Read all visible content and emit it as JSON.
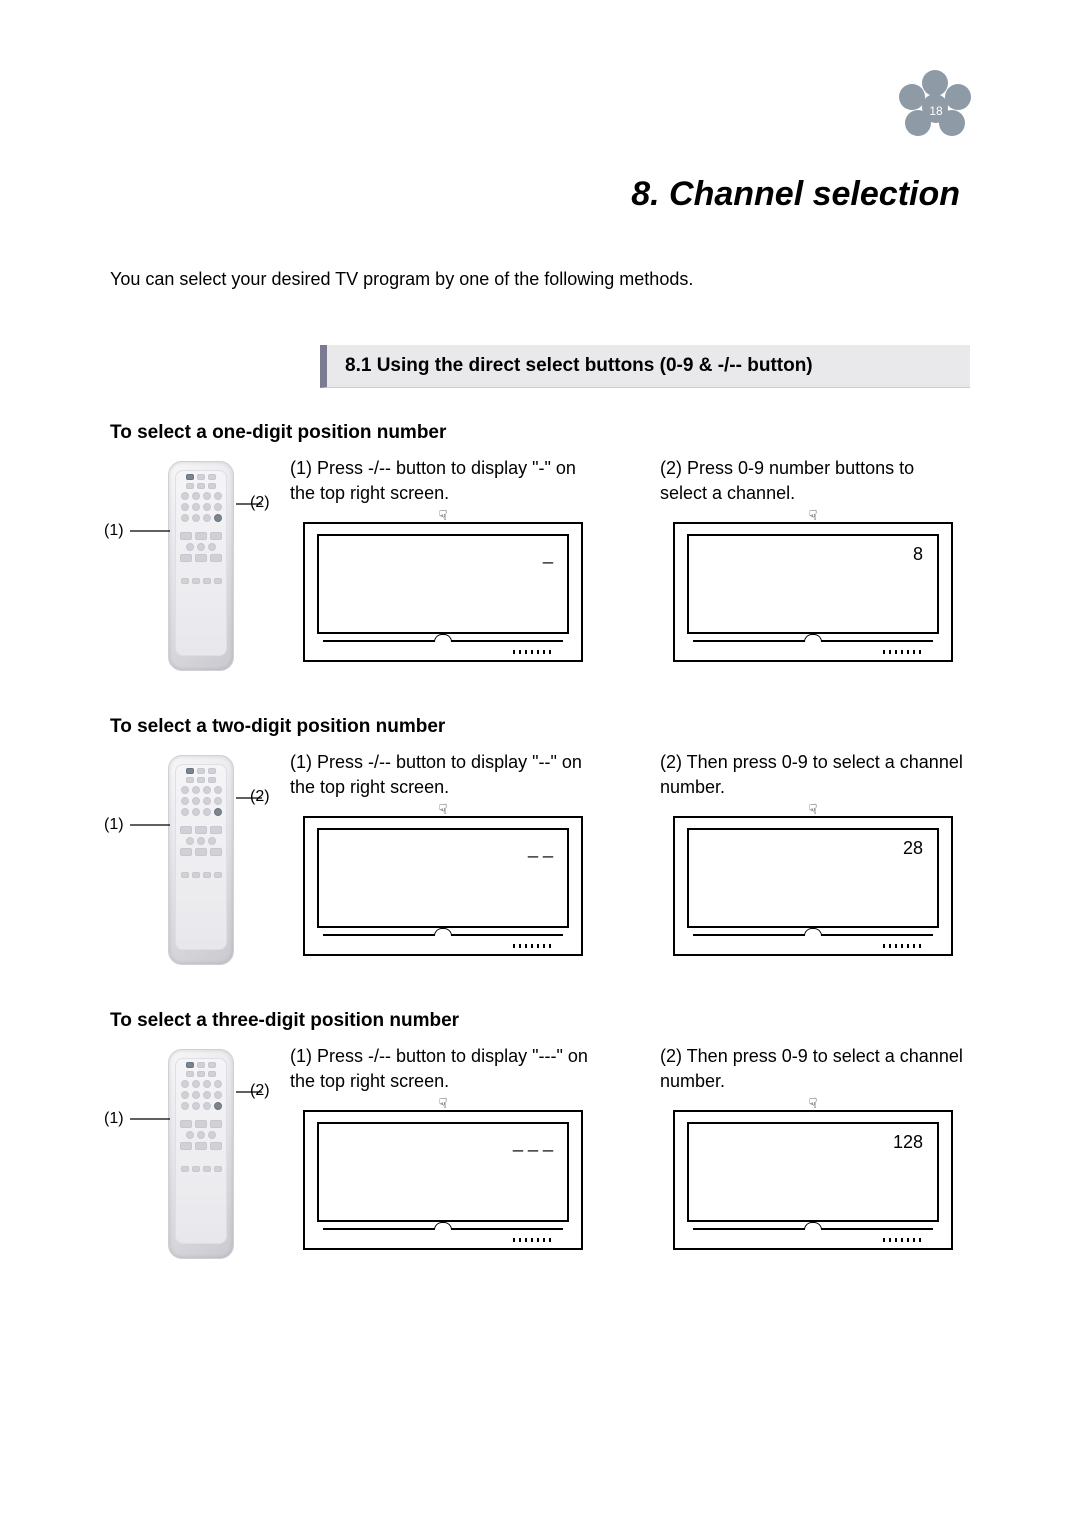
{
  "page_number": "18",
  "chapter_title": "8. Channel selection",
  "intro": "You can select your desired TV program by one of the following methods.",
  "section_title": "8.1 Using the direct select buttons (0-9 & -/-- button)",
  "callout_labels": {
    "one": "(1)",
    "two": "(2)"
  },
  "blocks": [
    {
      "subhead": "To select a one-digit position number",
      "step1_text": "(1) Press -/-- button to display \"-\" on the top right screen.",
      "tv1_display": "_",
      "step2_text": "(2) Press 0-9 number buttons to select a channel.",
      "tv2_display": "8"
    },
    {
      "subhead": "To select a two-digit position number",
      "step1_text": "(1) Press -/-- button to display \"--\" on the top right screen.",
      "tv1_display": "_ _",
      "step2_text": "(2) Then press 0-9 to select a channel number.",
      "tv2_display": "28"
    },
    {
      "subhead": "To select a three-digit position number",
      "step1_text": "(1) Press -/-- button to display \"---\" on the top right screen.",
      "tv1_display": "_ _ _",
      "step2_text": "(2) Then press 0-9 to select a channel number.",
      "tv2_display": "128"
    }
  ]
}
